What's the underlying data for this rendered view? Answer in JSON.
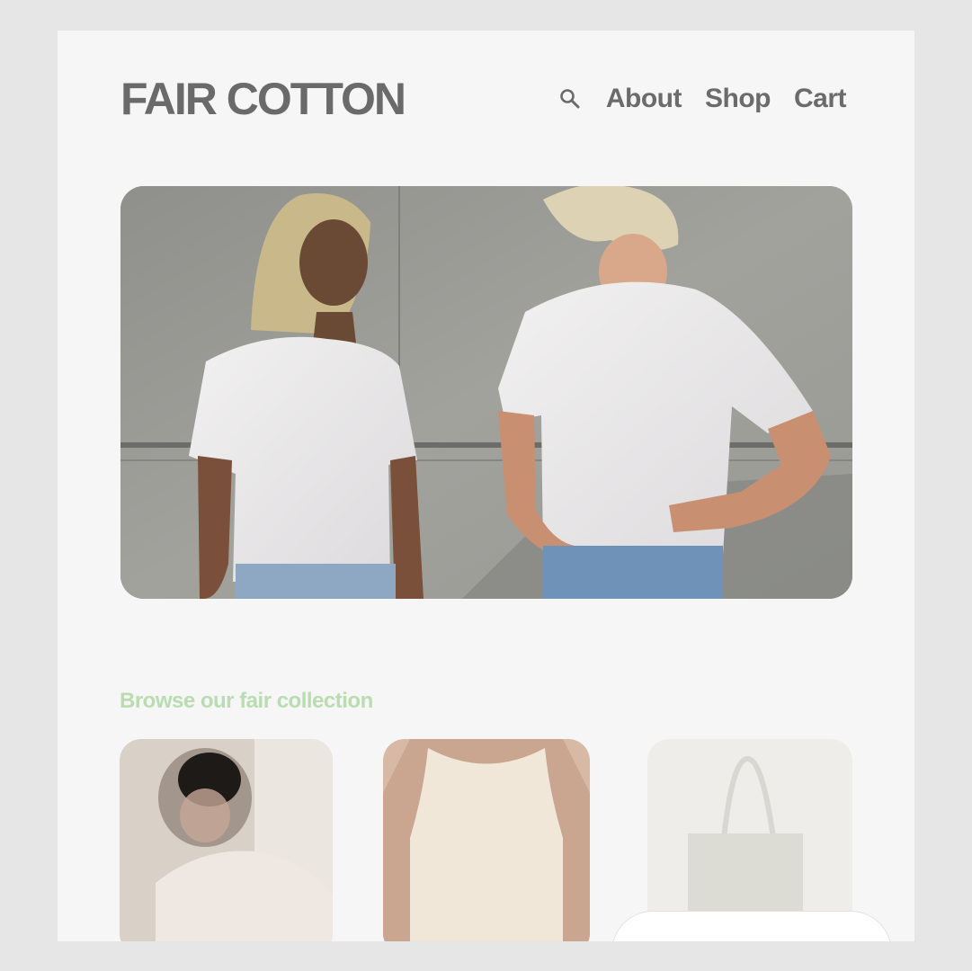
{
  "brand": {
    "name": "FAIR COTTON"
  },
  "nav": {
    "search_icon": "search-icon",
    "items": [
      {
        "label": "About"
      },
      {
        "label": "Shop"
      },
      {
        "label": "Cart"
      }
    ]
  },
  "colors": {
    "page_bg": "#f6f6f6",
    "outer_bg": "#e6e6e6",
    "brand_text": "#6a6a6a",
    "accent_green": "#b9dcb0"
  },
  "collection": {
    "title": "Browse our fair collection"
  }
}
